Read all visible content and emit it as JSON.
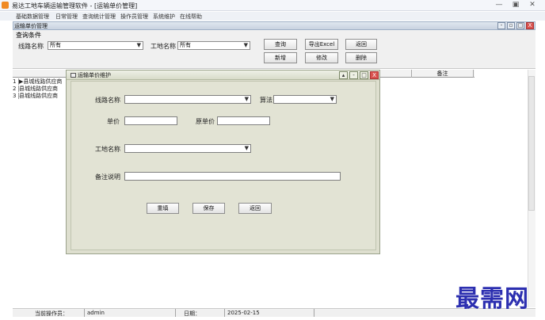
{
  "window": {
    "title": "易达工地车辆运输管理软件 - [运输单价管理]",
    "controls": [
      "—",
      "▣",
      "✕"
    ]
  },
  "menu": {
    "items": [
      "基础数据管理",
      "日常管理",
      "查询统计管理",
      "操作员管理",
      "系统维护",
      "在线帮助"
    ]
  },
  "child_window": {
    "title": "运输单价管理",
    "controls": [
      "-",
      "▫",
      "□",
      "X"
    ]
  },
  "query": {
    "section_label": "查询条件",
    "route_label": "线路名称",
    "route_value": "所有",
    "site_label": "工地名称",
    "site_value": "所有",
    "buttons": {
      "query": "查询",
      "export": "导出Excel",
      "back": "返回",
      "add": "新增",
      "edit": "修改",
      "delete": "删除"
    }
  },
  "grid": {
    "columns": [
      "",
      "备注"
    ],
    "rows": [
      {
        "num": "1",
        "marker": "▶",
        "text": "县城线路供应商"
      },
      {
        "num": "2",
        "marker": "",
        "text": "县城线路供应商"
      },
      {
        "num": "3",
        "marker": "",
        "text": "县城线路供应商"
      }
    ]
  },
  "dialog": {
    "title": "运输单价维护",
    "controls": [
      "▴",
      "-",
      "□",
      "X"
    ],
    "route_label": "线路名称",
    "method_label": "算法",
    "price_label": "单价",
    "orig_price_label": "原单价",
    "site_label": "工地名称",
    "remark_label": "备注说明",
    "buttons": {
      "reset": "重填",
      "save": "保存",
      "back": "返回"
    }
  },
  "status": {
    "operator_label": "当前操作员：",
    "operator_value": "admin",
    "date_label": "日期：",
    "date_value": "2025-02-15"
  },
  "watermark": "最需网",
  "colors": {
    "dialog_bg": "#dedfcf",
    "close_red": "#d9534f",
    "watermark_blue": "#2c2fb0",
    "app_icon_orange": "#f08a24"
  }
}
